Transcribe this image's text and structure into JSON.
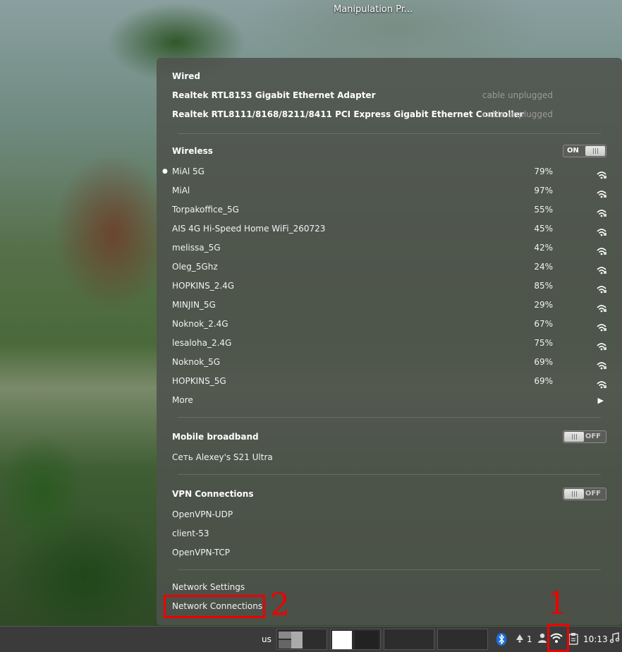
{
  "desktop": {
    "icon_label": "Manipulation Pr..."
  },
  "menu": {
    "wired": {
      "title": "Wired",
      "adapters": [
        {
          "name": "Realtek RTL8153 Gigabit Ethernet Adapter",
          "status": "cable unplugged"
        },
        {
          "name": "Realtek RTL8111/8168/8211/8411 PCI Express Gigabit Ethernet Controller",
          "status": "cable unplugged"
        }
      ]
    },
    "wireless": {
      "title": "Wireless",
      "toggle": "ON",
      "networks": [
        {
          "name": "MiAl 5G",
          "signal": "79%"
        },
        {
          "name": "MiAl",
          "signal": "97%"
        },
        {
          "name": "Torpakoffice_5G",
          "signal": "55%"
        },
        {
          "name": "AIS 4G Hi-Speed Home WiFi_260723",
          "signal": "45%"
        },
        {
          "name": "melissa_5G",
          "signal": "42%"
        },
        {
          "name": "Oleg_5Ghz",
          "signal": "24%"
        },
        {
          "name": "HOPKINS_2.4G",
          "signal": "85%"
        },
        {
          "name": "MINJIN_5G",
          "signal": "29%"
        },
        {
          "name": "Noknok_2.4G",
          "signal": "67%"
        },
        {
          "name": "lesaloha_2.4G",
          "signal": "75%"
        },
        {
          "name": "Noknok_5G",
          "signal": "69%"
        },
        {
          "name": "HOPKINS_5G",
          "signal": "69%"
        }
      ],
      "more_label": "More"
    },
    "mobile": {
      "title": "Mobile broadband",
      "toggle": "OFF",
      "items": [
        "Сеть Alexey's S21 Ultra"
      ]
    },
    "vpn": {
      "title": "VPN Connections",
      "toggle": "OFF",
      "items": [
        "OpenVPN-UDP",
        "client-53",
        "OpenVPN-TCP"
      ]
    },
    "footer": {
      "settings": "Network Settings",
      "connections": "Network Connections"
    }
  },
  "annotations": {
    "one": "1",
    "two": "2"
  },
  "taskbar": {
    "keyboard_layout": "us",
    "notification_count": "1",
    "clock": "10:13"
  },
  "colors": {
    "annotation_red": "#e00000",
    "panel_bg": "#3b3b3b"
  }
}
